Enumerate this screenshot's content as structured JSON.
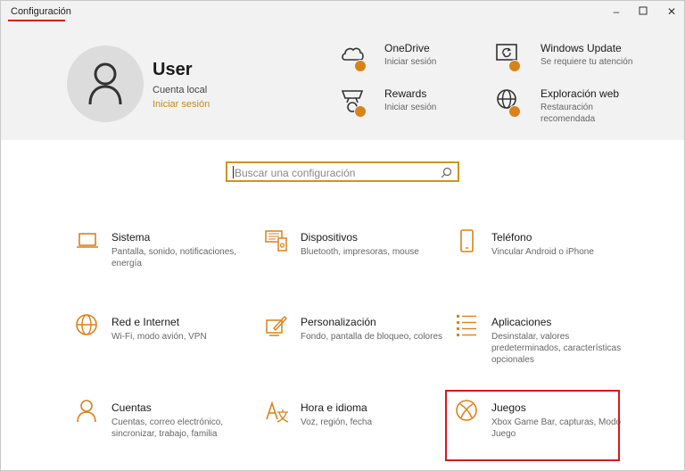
{
  "window": {
    "title": "Configuración",
    "accent": "#d9821a",
    "highlight_color": "#d71920"
  },
  "user": {
    "name": "User",
    "account": "Cuenta local",
    "signin": "Iniciar sesión"
  },
  "services": [
    {
      "title": "OneDrive",
      "subtitle": "Iniciar sesión",
      "icon": "cloud-icon"
    },
    {
      "title": "Rewards",
      "subtitle": "Iniciar sesión",
      "icon": "trophy-icon"
    },
    {
      "title": "Windows Update",
      "subtitle": "Se requiere tu atención",
      "icon": "update-icon"
    },
    {
      "title": "Exploración web",
      "subtitle": "Restauración recomendada",
      "icon": "globe-icon"
    }
  ],
  "search": {
    "placeholder": "Buscar una configuración"
  },
  "categories": [
    {
      "title": "Sistema",
      "subtitle": "Pantalla, sonido, notificaciones, energía",
      "icon": "laptop-icon"
    },
    {
      "title": "Dispositivos",
      "subtitle": "Bluetooth, impresoras, mouse",
      "icon": "devices-icon"
    },
    {
      "title": "Teléfono",
      "subtitle": "Vincular Android o iPhone",
      "icon": "phone-icon"
    },
    {
      "title": "Red e Internet",
      "subtitle": "Wi-Fi, modo avión, VPN",
      "icon": "globe-icon"
    },
    {
      "title": "Personalización",
      "subtitle": "Fondo, pantalla de bloqueo, colores",
      "icon": "paint-icon"
    },
    {
      "title": "Aplicaciones",
      "subtitle": "Desinstalar, valores predeterminados, características opcionales",
      "icon": "apps-list-icon"
    },
    {
      "title": "Cuentas",
      "subtitle": "Cuentas, correo electrónico, sincronizar, trabajo, familia",
      "icon": "person-icon"
    },
    {
      "title": "Hora e idioma",
      "subtitle": "Voz, región, fecha",
      "icon": "time-language-icon"
    },
    {
      "title": "Juegos",
      "subtitle": "Xbox Game Bar, capturas, Modo Juego",
      "icon": "xbox-icon"
    }
  ]
}
